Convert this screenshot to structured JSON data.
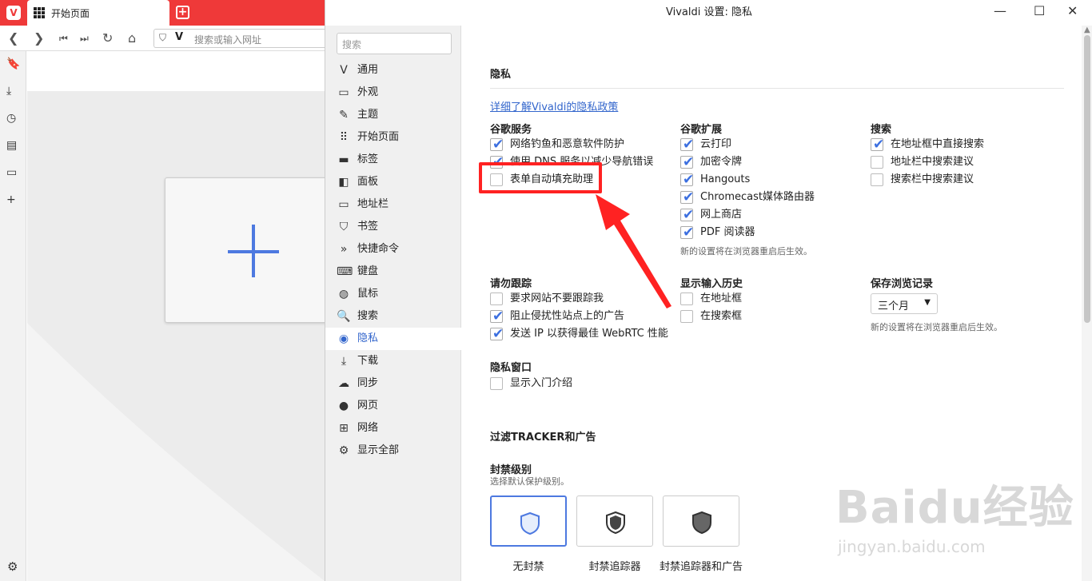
{
  "browser": {
    "tab_title": "开始页面",
    "address_placeholder": "搜索或输入网址"
  },
  "window": {
    "title": "Vivaldi 设置: 隐私"
  },
  "nav": {
    "search_placeholder": "搜索",
    "items": [
      {
        "label": "通用",
        "icon": "vivaldi-icon"
      },
      {
        "label": "外观",
        "icon": "folder-icon"
      },
      {
        "label": "主题",
        "icon": "brush-icon"
      },
      {
        "label": "开始页面",
        "icon": "grid-icon"
      },
      {
        "label": "标签",
        "icon": "tab-icon"
      },
      {
        "label": "面板",
        "icon": "panel-icon"
      },
      {
        "label": "地址栏",
        "icon": "addressbar-icon"
      },
      {
        "label": "书签",
        "icon": "bookmark-icon"
      },
      {
        "label": "快捷命令",
        "icon": "command-icon"
      },
      {
        "label": "键盘",
        "icon": "keyboard-icon"
      },
      {
        "label": "鼠标",
        "icon": "mouse-icon"
      },
      {
        "label": "搜索",
        "icon": "search-icon"
      },
      {
        "label": "隐私",
        "icon": "eye-icon"
      },
      {
        "label": "下载",
        "icon": "download-icon"
      },
      {
        "label": "同步",
        "icon": "cloud-icon"
      },
      {
        "label": "网页",
        "icon": "globe-icon"
      },
      {
        "label": "网络",
        "icon": "network-icon"
      },
      {
        "label": "显示全部",
        "icon": "gear-icon"
      }
    ],
    "active_index": 12
  },
  "privacy": {
    "heading": "隐私",
    "policy_link": "详细了解Vivaldi的隐私政策",
    "google_services": {
      "heading": "谷歌服务",
      "items": [
        {
          "label": "网络钓鱼和恶意软件防护",
          "checked": true
        },
        {
          "label": "使用 DNS 服务以减少导航错误",
          "checked": true
        },
        {
          "label": "表单自动填充助理",
          "checked": false
        }
      ]
    },
    "google_extensions": {
      "heading": "谷歌扩展",
      "items": [
        {
          "label": "云打印",
          "checked": true
        },
        {
          "label": "加密令牌",
          "checked": true
        },
        {
          "label": "Hangouts",
          "checked": true
        },
        {
          "label": "Chromecast媒体路由器",
          "checked": true
        },
        {
          "label": "网上商店",
          "checked": true
        },
        {
          "label": "PDF 阅读器",
          "checked": true
        }
      ],
      "note": "新的设置将在浏览器重启后生效。"
    },
    "search": {
      "heading": "搜索",
      "items": [
        {
          "label": "在地址框中直接搜索",
          "checked": true
        },
        {
          "label": "地址栏中搜索建议",
          "checked": false
        },
        {
          "label": "搜索栏中搜索建议",
          "checked": false
        }
      ]
    },
    "dnt": {
      "heading": "请勿跟踪",
      "items": [
        {
          "label": "要求网站不要跟踪我",
          "checked": false
        },
        {
          "label": "阻止侵扰性站点上的广告",
          "checked": true
        },
        {
          "label": "发送 IP 以获得最佳 WebRTC 性能",
          "checked": true
        }
      ]
    },
    "input_history": {
      "heading": "显示输入历史",
      "items": [
        {
          "label": "在地址框",
          "checked": false
        },
        {
          "label": "在搜索框",
          "checked": false
        }
      ]
    },
    "history": {
      "heading": "保存浏览记录",
      "value": "三个月",
      "note": "新的设置将在浏览器重启后生效。"
    },
    "private_window": {
      "heading": "隐私窗口",
      "items": [
        {
          "label": "显示入门介绍",
          "checked": false
        }
      ]
    },
    "tracker": {
      "heading": "过滤TRACKER和广告",
      "level_heading": "封禁级别",
      "level_sub": "选择默认保护级别。",
      "options": [
        {
          "label": "无封禁",
          "selected": true
        },
        {
          "label": "封禁追踪器",
          "selected": false
        },
        {
          "label": "封禁追踪器和广告",
          "selected": false
        }
      ]
    }
  },
  "watermark": {
    "brand": "Baidu经验",
    "url": "jingyan.baidu.com"
  },
  "colors": {
    "accent": "#3c6fe0",
    "vivaldi_red": "#ef3939",
    "annotation_red": "#ff2222"
  }
}
